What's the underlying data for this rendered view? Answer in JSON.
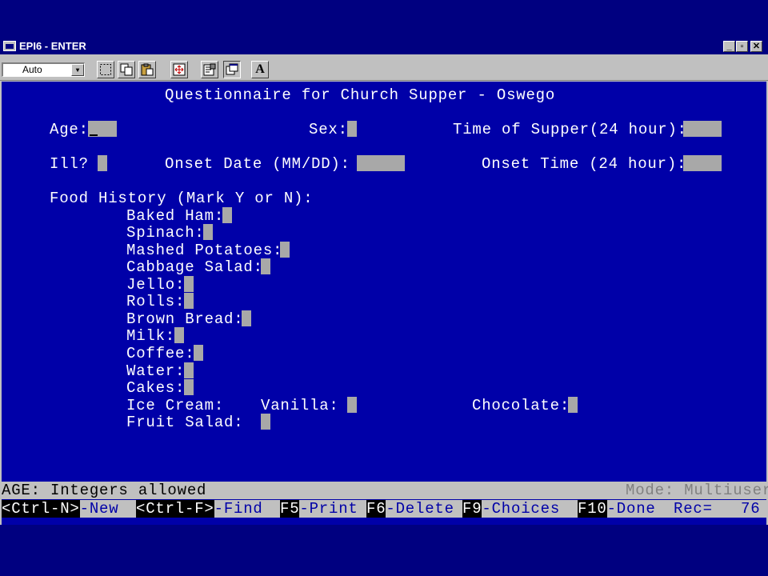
{
  "window": {
    "title": "EPI6 - ENTER"
  },
  "window_buttons": {
    "minimize": "_",
    "restore": "▫",
    "close": "✕"
  },
  "toolbar": {
    "font_select_value": "Auto",
    "text_button_label": "A"
  },
  "form": {
    "title": "Questionnaire for Church Supper - Oswego",
    "age_label": "Age:",
    "sex_label": "Sex:",
    "supper_time_label": "Time of Supper(24 hour):",
    "ill_label": "Ill?",
    "onset_date_label": "Onset Date (MM/DD):",
    "onset_time_label": "Onset Time (24 hour):",
    "food_history_label": "Food History (Mark Y or N):",
    "foods": {
      "baked_ham": "Baked Ham:",
      "spinach": "Spinach:",
      "mashed_potatoes": "Mashed Potatoes:",
      "cabbage_salad": "Cabbage Salad:",
      "jello": "Jello:",
      "rolls": "Rolls:",
      "brown_bread": "Brown Bread:",
      "milk": "Milk:",
      "coffee": "Coffee:",
      "water": "Water:",
      "cakes": "Cakes:",
      "ice_cream": "Ice Cream:",
      "vanilla": "Vanilla:",
      "chocolate": "Chocolate:",
      "fruit_salad": "Fruit Salad:"
    }
  },
  "status": {
    "help": "AGE: Integers allowed",
    "mode": "Mode: Multiuser"
  },
  "fkeys": {
    "new_key": "<Ctrl-N>",
    "new_label": "-New",
    "find_key": "<Ctrl-F>",
    "find_label": "-Find",
    "print_key": "F5",
    "print_label": "-Print",
    "delete_key": "F6",
    "delete_label": "-Delete",
    "choices_key": "F9",
    "choices_label": "-Choices",
    "done_key": "F10",
    "done_label": "-Done",
    "rec_label": "Rec=",
    "rec_value": "76"
  }
}
